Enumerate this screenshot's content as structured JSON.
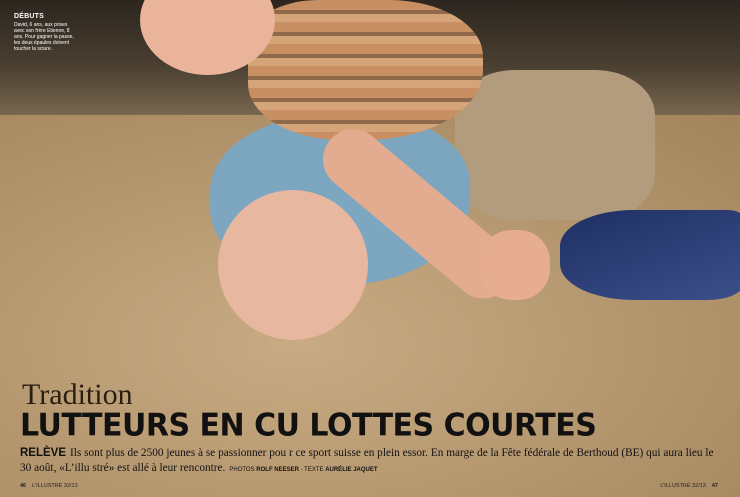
{
  "caption": {
    "title": "DÉBUTS",
    "text": "David, 6 ans, aux prises avec son frère Etienne, 8 ans. Pour gagner la passe, les deux épaules doivent toucher la sciure."
  },
  "article": {
    "kicker": "Tradition",
    "headline": "LUTTEURS EN CU LOTTES COURTES",
    "lead_word": "RELÈVE",
    "deck": "Ils sont plus de 2500 jeunes à se passionner pou r ce sport suisse en plein essor. En marge de la Fête fédérale de Berthoud (BE) qui aura lieu le 30 août, «L’illu stré» est allé à leur rencontre.",
    "credits_photos_label": "PHOTOS",
    "credits_photographer": "ROLF NEESER",
    "credits_separator": " - TEXTE ",
    "credits_writer": "AURÉLIE JAQUET"
  },
  "footer": {
    "left_page": "46",
    "left_issue": "L’ILLUSTRÉ 32/13",
    "right_issue": "L’ILLUSTRÉ 32/13",
    "right_page": "47"
  }
}
